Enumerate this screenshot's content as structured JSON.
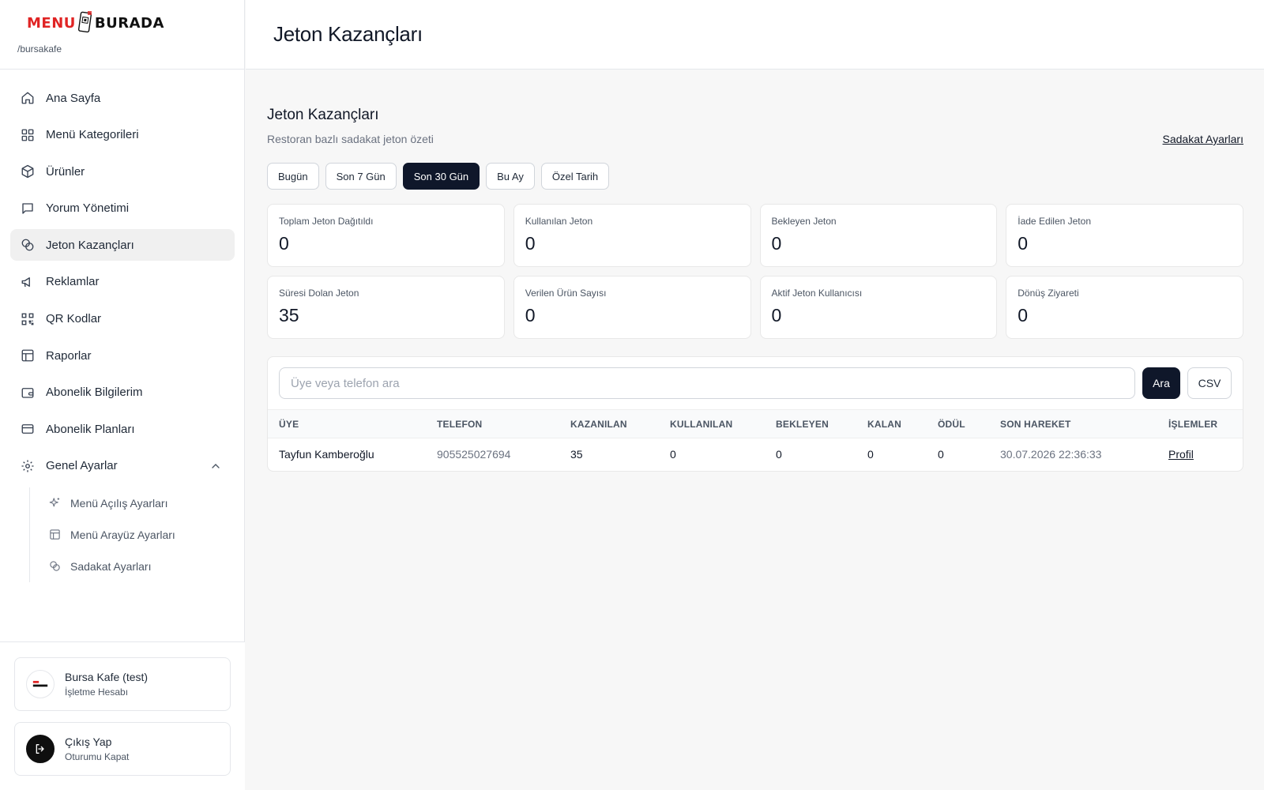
{
  "brand": {
    "logo_menu": "MENU",
    "logo_burada": "BURADA",
    "slug": "/bursakafe"
  },
  "sidebar": {
    "items": [
      {
        "label": "Ana Sayfa",
        "icon": "home-icon"
      },
      {
        "label": "Menü Kategorileri",
        "icon": "grid-icon"
      },
      {
        "label": "Ürünler",
        "icon": "box-icon"
      },
      {
        "label": "Yorum Yönetimi",
        "icon": "chat-icon"
      },
      {
        "label": "Jeton Kazançları",
        "icon": "coins-icon",
        "active": true
      },
      {
        "label": "Reklamlar",
        "icon": "megaphone-icon"
      },
      {
        "label": "QR Kodlar",
        "icon": "qr-icon"
      },
      {
        "label": "Raporlar",
        "icon": "layout-icon"
      },
      {
        "label": "Abonelik Bilgilerim",
        "icon": "wallet-icon"
      },
      {
        "label": "Abonelik Planları",
        "icon": "card-icon"
      }
    ],
    "group": {
      "label": "Genel Ayarlar",
      "icon": "gear-icon",
      "expanded": true,
      "children": [
        {
          "label": "Menü Açılış Ayarları",
          "icon": "sparkles-icon"
        },
        {
          "label": "Menü Arayüz Ayarları",
          "icon": "layout-icon"
        },
        {
          "label": "Sadakat Ayarları",
          "icon": "coins-icon"
        }
      ]
    },
    "account": {
      "title": "Bursa Kafe (test)",
      "subtitle": "İşletme Hesabı"
    },
    "logout": {
      "title": "Çıkış Yap",
      "subtitle": "Oturumu Kapat"
    }
  },
  "header": {
    "title": "Jeton Kazançları"
  },
  "section": {
    "title": "Jeton Kazançları",
    "subtitle": "Restoran bazlı sadakat jeton özeti",
    "settings_link": "Sadakat Ayarları"
  },
  "filters": {
    "options": [
      "Bugün",
      "Son 7 Gün",
      "Son 30 Gün",
      "Bu Ay",
      "Özel Tarih"
    ],
    "selected": "Son 30 Gün"
  },
  "stats": [
    {
      "label": "Toplam Jeton Dağıtıldı",
      "value": "0"
    },
    {
      "label": "Kullanılan Jeton",
      "value": "0"
    },
    {
      "label": "Bekleyen Jeton",
      "value": "0"
    },
    {
      "label": "İade Edilen Jeton",
      "value": "0"
    },
    {
      "label": "Süresi Dolan Jeton",
      "value": "35"
    },
    {
      "label": "Verilen Ürün Sayısı",
      "value": "0"
    },
    {
      "label": "Aktif Jeton Kullanıcısı",
      "value": "0"
    },
    {
      "label": "Dönüş Ziyareti",
      "value": "0"
    }
  ],
  "search": {
    "placeholder": "Üye veya telefon ara",
    "value": "",
    "search_button": "Ara",
    "csv_button": "CSV"
  },
  "table": {
    "columns": [
      "ÜYE",
      "TELEFON",
      "KAZANILAN",
      "KULLANILAN",
      "BEKLEYEN",
      "KALAN",
      "ÖDÜL",
      "SON HAREKET",
      "İŞLEMLER"
    ],
    "rows": [
      {
        "member": "Tayfun Kamberoğlu",
        "phone": "905525027694",
        "earned": "35",
        "used": "0",
        "pending": "0",
        "remaining": "0",
        "reward": "0",
        "last_activity": "30.07.2026 22:36:33",
        "action": "Profil"
      }
    ]
  },
  "colors": {
    "accent_dark": "#0f172a",
    "brand_red": "#e02424",
    "active_nav_bg": "#f0f0f0"
  }
}
